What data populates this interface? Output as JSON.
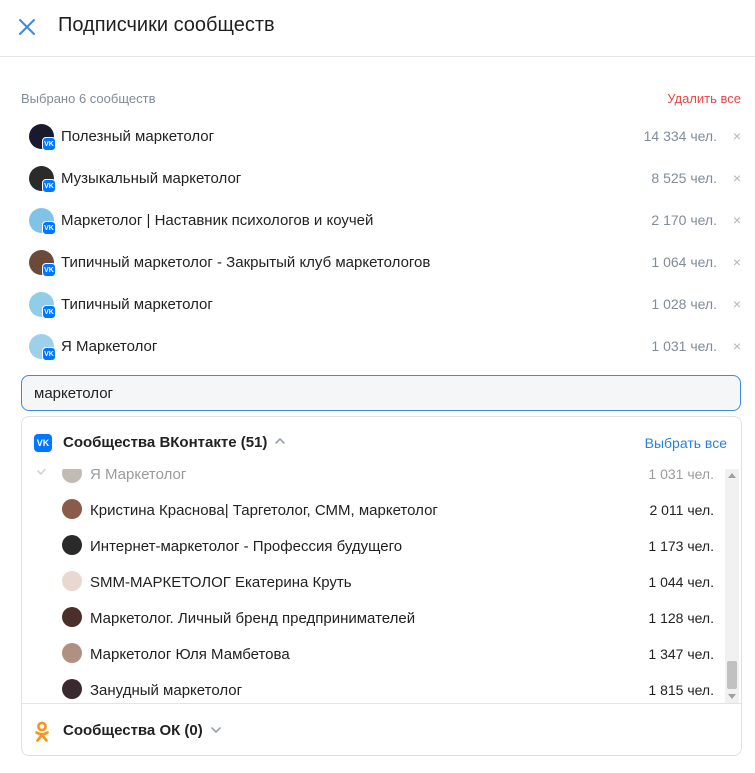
{
  "header": {
    "title": "Подписчики сообществ"
  },
  "selected": {
    "label": "Выбрано 6 сообществ",
    "remove_all": "Удалить все",
    "remove_glyph": "×",
    "items": [
      {
        "name": "Полезный маркетолог",
        "count": "14 334 чел.",
        "avatar_color": "#1a1a2e"
      },
      {
        "name": "Музыкальный маркетолог",
        "count": "8 525 чел.",
        "avatar_color": "#2b2b2b"
      },
      {
        "name": "Маркетолог | Наставник психологов и коучей",
        "count": "2 170 чел.",
        "avatar_color": "#7fc4e6"
      },
      {
        "name": "Типичный маркетолог - Закрытый клуб маркетологов",
        "count": "1 064 чел.",
        "avatar_color": "#6b4a3a"
      },
      {
        "name": "Типичный маркетолог",
        "count": "1 028 чел.",
        "avatar_color": "#8fcde8"
      },
      {
        "name": "Я Маркетолог",
        "count": "1 031 чел.",
        "avatar_color": "#9ed0ea"
      }
    ]
  },
  "search": {
    "value": "маркетолог"
  },
  "vk_section": {
    "title": "Сообщества ВКонтакте (51)",
    "select_all": "Выбрать все",
    "logo_text": "VK",
    "items": [
      {
        "name": "Я Маркетолог",
        "count": "1 031 чел.",
        "checked": true,
        "avatar_color": "#7a6a5a"
      },
      {
        "name": "Кристина Краснова| Таргетолог, СММ, маркетолог",
        "count": "2 011 чел.",
        "checked": false,
        "avatar_color": "#8a5a4a"
      },
      {
        "name": "Интернет-маркетолог - Профессия будущего",
        "count": "1 173 чел.",
        "checked": false,
        "avatar_color": "#2a2a2a"
      },
      {
        "name": "SMM-МАРКЕТОЛОГ Екатерина Круть",
        "count": "1 044 чел.",
        "checked": false,
        "avatar_color": "#e8d8d0"
      },
      {
        "name": "Маркетолог. Личный бренд предпринимателей",
        "count": "1 128 чел.",
        "checked": false,
        "avatar_color": "#4a3028"
      },
      {
        "name": "Маркетолог Юля Мамбетова",
        "count": "1 347 чел.",
        "checked": false,
        "avatar_color": "#b09080"
      },
      {
        "name": "Занудный маркетолог",
        "count": "1 815 чел.",
        "checked": false,
        "avatar_color": "#3a2a30"
      }
    ]
  },
  "ok_section": {
    "title": "Сообщества ОК (0)"
  },
  "colors": {
    "accent": "#2a80e0",
    "danger": "#e64646",
    "vk": "#0077ff",
    "ok": "#f7931e"
  }
}
